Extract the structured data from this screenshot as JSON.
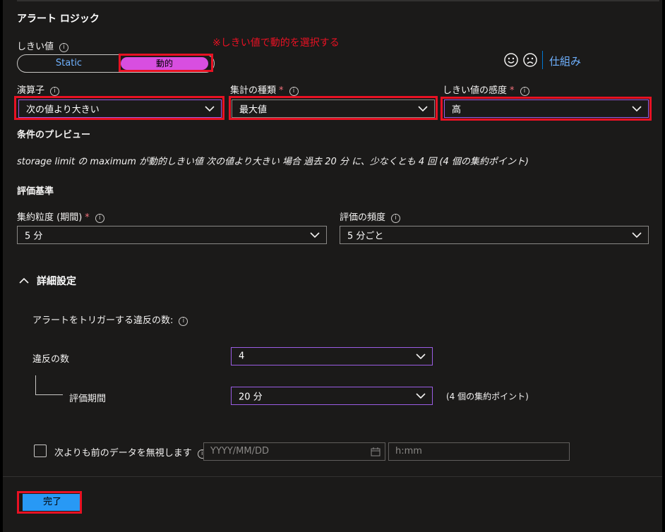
{
  "section_title": "アラート ロジック",
  "threshold": {
    "label": "しきい値",
    "options": {
      "static": "Static",
      "dynamic": "動的"
    },
    "selected": "動的",
    "annotation": "※しきい値で動的を選択する"
  },
  "how_it_works": "仕組み",
  "operator": {
    "label": "演算子",
    "value": "次の値より大きい"
  },
  "aggregation_type": {
    "label": "集計の種類",
    "required": "*",
    "value": "最大値"
  },
  "sensitivity": {
    "label": "しきい値の感度",
    "required": "*",
    "value": "高"
  },
  "condition_preview": {
    "label": "条件のプレビュー",
    "text": "storage limit の maximum が動的しきい値 次の値より大きい 場合 過去 20 分 に、少なくとも 4 回 (4 個の集約ポイント)"
  },
  "evaluation": {
    "heading": "評価基準",
    "granularity": {
      "label": "集約粒度 (期間)",
      "required": "*",
      "value": "5 分"
    },
    "frequency": {
      "label": "評価の頻度",
      "value": "5 分ごと"
    }
  },
  "advanced": {
    "heading": "詳細設定",
    "violations_label": "アラートをトリガーする違反の数:",
    "num_violations": {
      "label": "違反の数",
      "value": "4"
    },
    "eval_period": {
      "label": "評価期間",
      "value": "20 分",
      "note": "(4 個の集約ポイント)"
    },
    "ignore_before": {
      "label": "次よりも前のデータを無視します",
      "date_placeholder": "YYYY/MM/DD",
      "time_placeholder": "h:mm"
    }
  },
  "done_button": "完了",
  "colors": {
    "accent": "#2899f5",
    "highlight": "#e81123",
    "dynamic_toggle": "#d84ee0"
  }
}
